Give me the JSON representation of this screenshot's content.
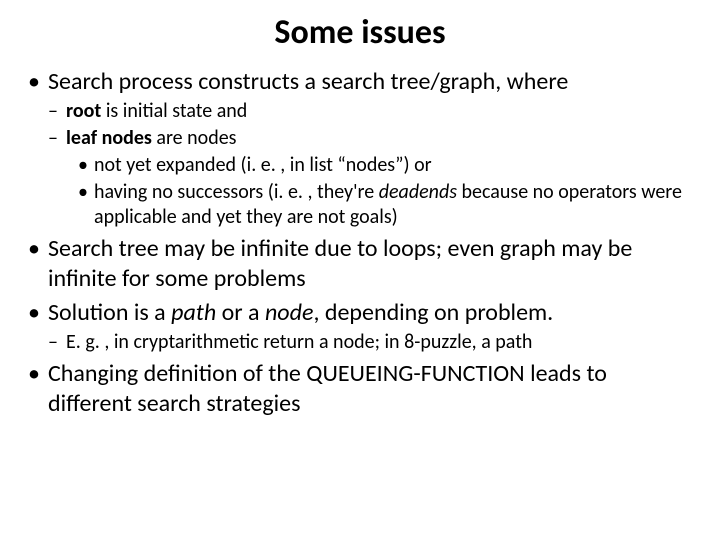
{
  "title": "Some issues",
  "bullets": {
    "b1": "Search process constructs a search tree/graph, where",
    "b1_sub1_bold": "root",
    "b1_sub1_rest": " is initial state and",
    "b1_sub2_bold": "leaf nodes",
    "b1_sub2_rest": " are nodes",
    "b1_sub2_a": "not yet expanded (i. e. , in list “nodes”) or",
    "b1_sub2_b_pre": "having no successors (i. e. , they're ",
    "b1_sub2_b_em": "deadends",
    "b1_sub2_b_post": " because no operators were applicable and yet they are not goals)",
    "b2": "Search tree may be infinite due to loops;  even graph may be infinite for some problems",
    "b3_pre": "Solution is a ",
    "b3_em1": "path",
    "b3_mid": " or a ",
    "b3_em2": "node",
    "b3_post": ", depending on problem.",
    "b3_sub1": "E. g. , in cryptarithmetic return a node; in 8-puzzle, a path",
    "b4": "Changing definition of the QUEUEING-FUNCTION leads to different search strategies"
  }
}
